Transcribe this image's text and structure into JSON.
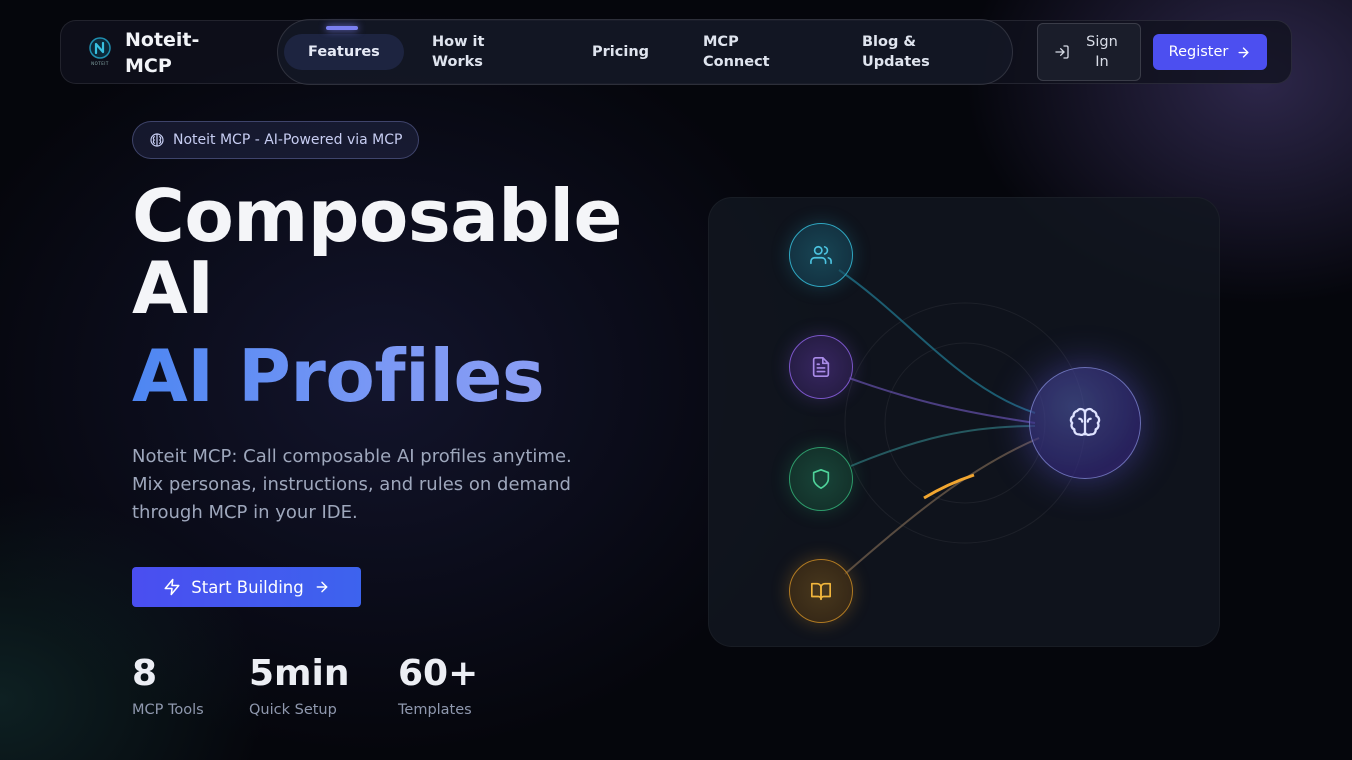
{
  "nav": {
    "brand_name": "Noteit-MCP",
    "brand_logo_caption": "NOTEIT",
    "links": [
      {
        "label": "Features",
        "active": true
      },
      {
        "label": "How it Works"
      },
      {
        "label": "Pricing"
      },
      {
        "label": "MCP Connect"
      },
      {
        "label": "Blog & Updates"
      }
    ],
    "sign_in_label": "Sign In",
    "register_label": "Register"
  },
  "hero": {
    "badge_text": "Noteit MCP - AI-Powered via MCP",
    "headline_line1": "Composable",
    "headline_line2": "AI",
    "headline_accent": "AI Profiles",
    "description": "Noteit MCP: Call composable AI profiles anytime. Mix personas, instructions, and rules on demand through MCP in your IDE.",
    "cta_label": "Start Building",
    "stats": [
      {
        "value": "8",
        "label": "MCP Tools"
      },
      {
        "value": "5min",
        "label": "Quick Setup"
      },
      {
        "value": "60+",
        "label": "Templates"
      }
    ]
  },
  "visual": {
    "nodes": [
      {
        "icon": "users-icon",
        "color": "#4cc3e0"
      },
      {
        "icon": "document-icon",
        "color": "#a98be8"
      },
      {
        "icon": "shield-icon",
        "color": "#4fd39a"
      },
      {
        "icon": "book-icon",
        "color": "#f2b63c"
      }
    ],
    "hub_icon": "brain-icon"
  },
  "colors": {
    "accent": "#4c4ff0",
    "headline_accent": "#5b86f0",
    "background": "#05060c"
  }
}
